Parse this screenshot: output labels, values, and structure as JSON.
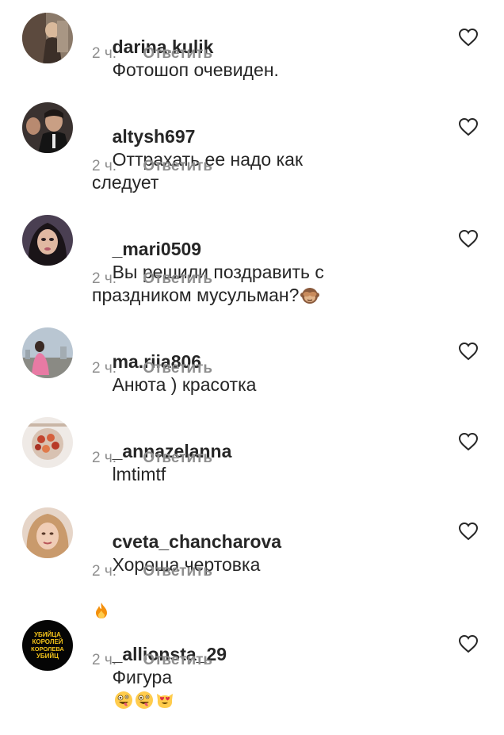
{
  "comments": [
    {
      "username": "darina.kulik",
      "text": "Фотошоп очевиден.",
      "time": "2 ч.",
      "reply": "Ответить",
      "avatar_icon": "avatar-photo"
    },
    {
      "username": "altysh697",
      "text": "Оттрахать ее надо как\nследует",
      "time": "2 ч.",
      "reply": "Ответить",
      "avatar_icon": "avatar-photo"
    },
    {
      "username": "_mari0509",
      "text": "Вы решили поздравить с\nпраздником мусульман?",
      "emoji": [
        "see-no-evil-monkey-emoji"
      ],
      "time": "2 ч.",
      "reply": "Ответить",
      "avatar_icon": "avatar-photo"
    },
    {
      "username": "ma.riia806",
      "text": "Анюта ) красотка",
      "time": "2 ч.",
      "reply": "Ответить",
      "avatar_icon": "avatar-photo"
    },
    {
      "username": "_annazelanna",
      "text": "lmtimtf",
      "time": "2 ч.",
      "reply": "Ответить",
      "avatar_icon": "avatar-photo"
    },
    {
      "username": "cveta_chancharova",
      "text": "Хороша чертовка",
      "emoji": [
        "fire-emoji"
      ],
      "time": "2 ч.",
      "reply": "Ответить",
      "avatar_icon": "avatar-photo"
    },
    {
      "username": "_allionsta_29",
      "text": "Фигура",
      "emoji": [
        "zany-face-emoji",
        "zany-face-emoji",
        "heart-eyes-cat-emoji"
      ],
      "time": "2 ч.",
      "reply": "Ответить",
      "avatar_icon": "avatar-logo",
      "avatar_text": "УБИЙЦА КОРОЛЕЙ КОРОЛЕВА УБИЙЦ"
    }
  ],
  "like_icon": "heart-outline-icon",
  "colors": {
    "text": "#262626",
    "secondary": "#8e8e8e",
    "background": "#ffffff"
  }
}
